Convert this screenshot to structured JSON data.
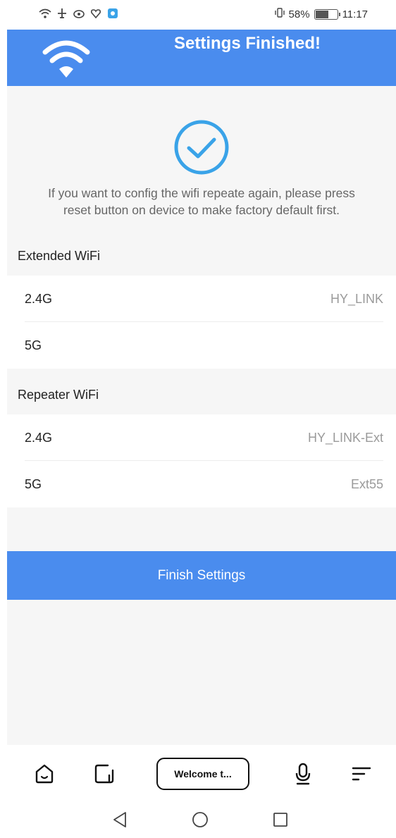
{
  "status_bar": {
    "battery_percent": "58%",
    "time": "11:17",
    "battery_level": 0.58
  },
  "header": {
    "title": "Settings Finished!",
    "icon": "wifi-icon",
    "color": "#4a8cee"
  },
  "result": {
    "icon": "check-circle-icon",
    "message_line1": "If you want to config the wifi repeate again, please press",
    "message_line2": "reset button on device to make factory default first."
  },
  "extended_wifi": {
    "title": "Extended WiFi",
    "rows": [
      {
        "band": "2.4G",
        "ssid": "HY_LINK"
      },
      {
        "band": "5G",
        "ssid": ""
      }
    ]
  },
  "repeater_wifi": {
    "title": "Repeater WiFi",
    "rows": [
      {
        "band": "2.4G",
        "ssid": "HY_LINK-Ext"
      },
      {
        "band": "5G",
        "ssid": "Ext55"
      }
    ]
  },
  "finish_button": {
    "label": "Finish Settings"
  },
  "browser_toolbar": {
    "tab_label": "Welcome t...",
    "icons": [
      "home-icon",
      "tabs-icon",
      "microphone-icon",
      "menu-icon"
    ]
  },
  "nav_bar": {
    "icons": [
      "back-icon",
      "home-circle-icon",
      "recents-icon"
    ]
  }
}
